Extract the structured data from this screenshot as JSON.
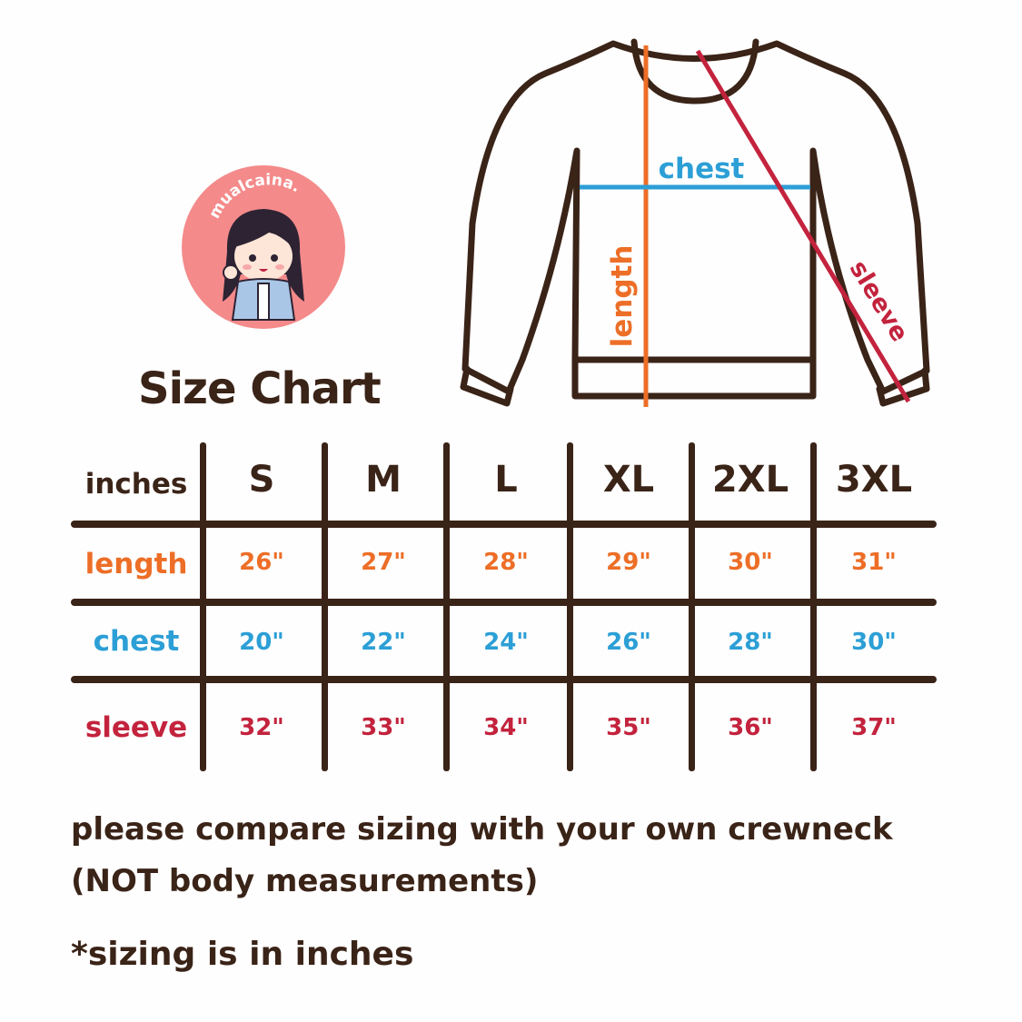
{
  "logo": {
    "brand": "mualcaina.",
    "icon": "chibi-girl-avatar"
  },
  "title": "Size Chart",
  "diagram": {
    "chest_label": "chest",
    "length_label": "length",
    "sleeve_label": "sleeve"
  },
  "table": {
    "unit_header": "inches",
    "sizes": [
      "S",
      "M",
      "L",
      "XL",
      "2XL",
      "3XL"
    ],
    "rows": [
      {
        "label": "length",
        "values": [
          "26\"",
          "27\"",
          "28\"",
          "29\"",
          "30\"",
          "31\""
        ]
      },
      {
        "label": "chest",
        "values": [
          "20\"",
          "22\"",
          "24\"",
          "26\"",
          "28\"",
          "30\""
        ]
      },
      {
        "label": "sleeve",
        "values": [
          "32\"",
          "33\"",
          "34\"",
          "35\"",
          "36\"",
          "37\""
        ]
      }
    ]
  },
  "notes": {
    "line1": "please compare sizing with your own crewneck",
    "line2": "(NOT body measurements)",
    "line3": "*sizing is in inches"
  },
  "colors": {
    "text": "#3a2317",
    "length": "#ed6e27",
    "chest": "#2c9fd6",
    "sleeve": "#c3233d",
    "logo_bg": "#f48a8a"
  }
}
